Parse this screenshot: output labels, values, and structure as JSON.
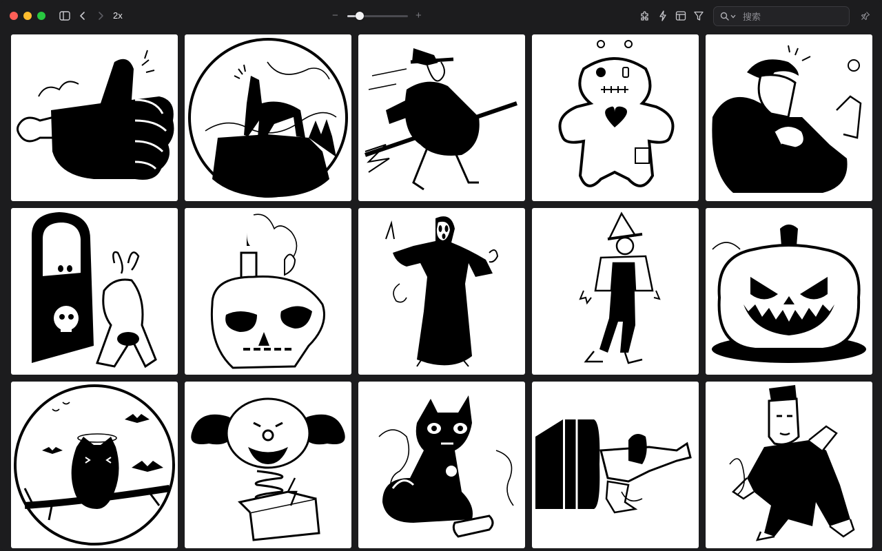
{
  "window": {
    "traffic_lights": [
      {
        "name": "close",
        "color": "#ff5f57"
      },
      {
        "name": "minimize",
        "color": "#febc2e"
      },
      {
        "name": "zoom",
        "color": "#28c840"
      }
    ]
  },
  "toolbar": {
    "zoom_label": "2x",
    "slider_minus": "−",
    "slider_plus": "+",
    "thumbnail_size": 0.2,
    "search_placeholder": "搜索"
  },
  "icons": {
    "sidebar_toggle": "sidebar-icon",
    "back": "chevron-left-icon",
    "forward": "chevron-right-icon",
    "extensions": "puzzle-icon",
    "actions": "bolt-icon",
    "layout": "layout-icon",
    "filter": "filter-icon",
    "search": "magnifier-icon",
    "pin": "pin-icon"
  },
  "gallery": {
    "items": [
      {
        "id": "thumbs-up-hand"
      },
      {
        "id": "howling-wolf-moon"
      },
      {
        "id": "flying-witch-broom"
      },
      {
        "id": "voodoo-doll"
      },
      {
        "id": "vampire-with-flower"
      },
      {
        "id": "trick-or-treat-door"
      },
      {
        "id": "skull-with-candle"
      },
      {
        "id": "ghostface-reaper"
      },
      {
        "id": "scarecrow"
      },
      {
        "id": "jack-o-lantern"
      },
      {
        "id": "owl-with-bats"
      },
      {
        "id": "clown-jack-in-box"
      },
      {
        "id": "skeleton-cat"
      },
      {
        "id": "zombie-from-door"
      },
      {
        "id": "frankenstein-zombie"
      }
    ]
  }
}
